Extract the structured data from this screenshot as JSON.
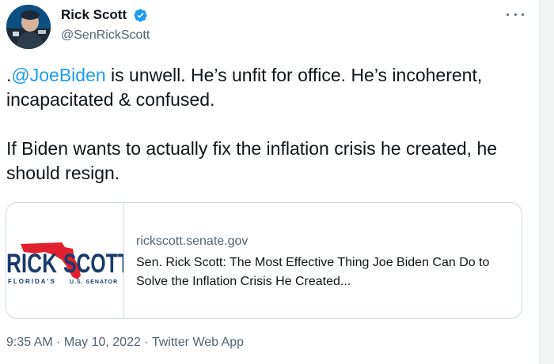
{
  "author": {
    "name": "Rick Scott",
    "handle": "@SenRickScott"
  },
  "tweet": {
    "prefix": ".",
    "mention": "@JoeBiden",
    "line1_rest": " is unwell. He’s unfit for office. He’s incoherent, incapacitated & confused.",
    "paragraph2": "If Biden wants to actually fix the inflation crisis he created, he should resign."
  },
  "card": {
    "domain": "rickscott.senate.gov",
    "title": "Sen. Rick Scott: The Most Effective Thing Joe Biden Can Do to Solve the Inflation Crisis He Created...",
    "thumbnail": {
      "logo_word_1": "RICK",
      "logo_word_2": "SCOTT",
      "logo_sub_left": "FLORIDA'S",
      "logo_sub_right": "U.S. SENATOR"
    }
  },
  "meta": {
    "time": "9:35 AM",
    "separator": " · ",
    "date": "May 10, 2022",
    "source": "Twitter Web App"
  },
  "colors": {
    "accent": "#1d9bf0",
    "text": "#0f1419",
    "secondary": "#536471",
    "border": "#cfd9de",
    "logo_blue": "#1a3a6e",
    "logo_red": "#e0202c"
  },
  "icons": [
    "verified-badge-icon",
    "more-options-icon"
  ]
}
